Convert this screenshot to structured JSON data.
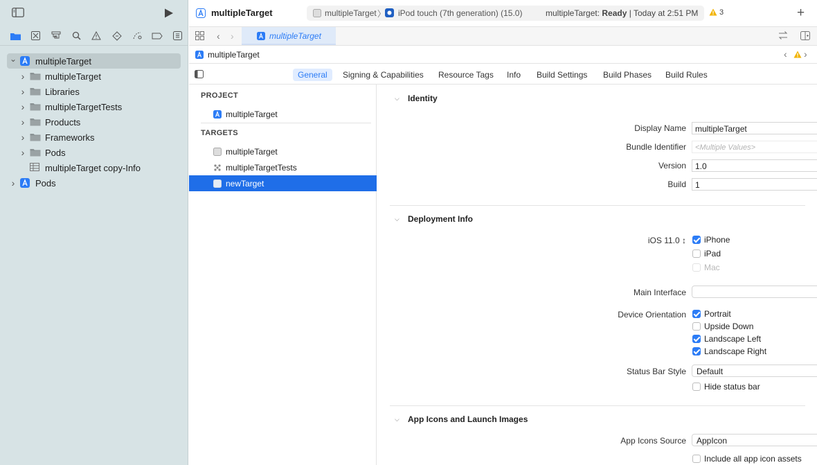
{
  "navigator": {
    "tree": [
      {
        "label": "multipleTarget",
        "level": 0,
        "expanded": true,
        "icon": "xcodeproj-icon",
        "selected": true
      },
      {
        "label": "multipleTarget",
        "level": 1,
        "expanded": false,
        "icon": "folder-icon"
      },
      {
        "label": "Libraries",
        "level": 1,
        "expanded": false,
        "icon": "folder-icon"
      },
      {
        "label": "multipleTargetTests",
        "level": 1,
        "expanded": false,
        "icon": "folder-icon"
      },
      {
        "label": "Products",
        "level": 1,
        "expanded": false,
        "icon": "folder-icon"
      },
      {
        "label": "Frameworks",
        "level": 1,
        "expanded": false,
        "icon": "folder-icon"
      },
      {
        "label": "Pods",
        "level": 1,
        "expanded": false,
        "icon": "folder-icon"
      },
      {
        "label": "multipleTarget copy-Info",
        "level": 1,
        "expanded": null,
        "icon": "plist-icon"
      },
      {
        "label": "Pods",
        "level": 0,
        "expanded": false,
        "icon": "xcodeproj-icon"
      }
    ]
  },
  "toolbar": {
    "project_title": "multipleTarget",
    "scheme": "multipleTarget",
    "destination": "iPod touch (7th generation) (15.0)",
    "status_prefix": "multipleTarget: ",
    "status_state": "Ready",
    "status_suffix": " | Today at 2:51 PM",
    "warning_count": "3"
  },
  "tabbar": {
    "open_tab": "multipleTarget"
  },
  "jumpbar": {
    "item": "multipleTarget"
  },
  "editor_tabs": [
    "General",
    "Signing & Capabilities",
    "Resource Tags",
    "Info",
    "Build Settings",
    "Build Phases",
    "Build Rules"
  ],
  "targets_pane": {
    "project_header": "PROJECT",
    "project_item": "multipleTarget",
    "targets_header": "TARGETS",
    "targets": [
      "multipleTarget",
      "multipleTargetTests",
      "newTarget"
    ],
    "selected_target": "newTarget"
  },
  "identity": {
    "section_title": "Identity",
    "display_name_label": "Display Name",
    "display_name_value": "multipleTarget",
    "bundle_id_label": "Bundle Identifier",
    "bundle_id_placeholder": "<Multiple Values>",
    "version_label": "Version",
    "version_value": "1.0",
    "build_label": "Build",
    "build_value": "1"
  },
  "deployment": {
    "section_title": "Deployment Info",
    "ios_version": "iOS 11.0 ↕",
    "devices": [
      {
        "label": "iPhone",
        "checked": true,
        "disabled": false
      },
      {
        "label": "iPad",
        "checked": false,
        "disabled": false
      },
      {
        "label": "Mac",
        "checked": false,
        "disabled": true
      }
    ],
    "main_interface_label": "Main Interface",
    "main_interface_value": "",
    "orientation_label": "Device Orientation",
    "orientations": [
      {
        "label": "Portrait",
        "checked": true
      },
      {
        "label": "Upside Down",
        "checked": false
      },
      {
        "label": "Landscape Left",
        "checked": true
      },
      {
        "label": "Landscape Right",
        "checked": true
      }
    ],
    "status_bar_label": "Status Bar Style",
    "status_bar_value": "Default",
    "hide_status_bar_label": "Hide status bar",
    "hide_status_bar_checked": false
  },
  "app_icons": {
    "section_title": "App Icons and Launch Images",
    "source_label": "App Icons Source",
    "source_value": "AppIcon",
    "include_all_label": "Include all app icon assets",
    "include_all_checked": false
  },
  "colors": {
    "accent": "#2c7cf6",
    "selection": "#1f6ee8",
    "navigator_bg": "#d7e3e5",
    "warning": "#f2b300"
  }
}
